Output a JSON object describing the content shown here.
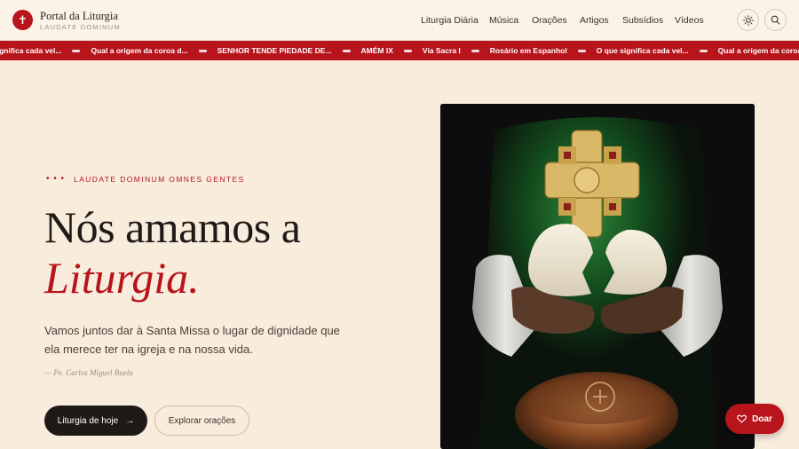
{
  "brand": {
    "title": "Portal da Liturgia",
    "subtitle": "LAUDATE DOMINUM",
    "logo_icon": "cross-icon"
  },
  "nav": {
    "items": [
      "Liturgia Diária",
      "Música",
      "Orações",
      "Artigos",
      "Subsídios",
      "Vídeos"
    ],
    "theme_icon": "sun-icon",
    "search_icon": "search-icon"
  },
  "ticker": {
    "items": [
      "significa cada vel...",
      "Qual a origem da coroa d...",
      "SENHOR TENDE PIEDADE DE...",
      "AMÉM IX",
      "Via Sacra I",
      "Rosário em Espanhol",
      "O que significa cada vel...",
      "Qual a origem da coroa d..."
    ]
  },
  "hero": {
    "eyebrow_dots": "• • •",
    "eyebrow": "LAUDATE DOMINUM OMNES GENTES",
    "headline_line1": "Nós amamos a",
    "headline_line2": "Liturgia.",
    "lead": "Vamos juntos dar à Santa Missa o lugar de dignidade que ela merece ter na igreja e na nossa vida.",
    "quote": "— Pe. Carlos Miguel Buela",
    "primary_button": "Liturgia de hoje",
    "primary_arrow": "→",
    "secondary_button": "Explorar orações"
  },
  "donate": {
    "label": "Doar",
    "icon": "heart-icon"
  },
  "colors": {
    "accent": "#b8141c",
    "background": "#f8ecdc",
    "dark": "#1f1a17"
  }
}
